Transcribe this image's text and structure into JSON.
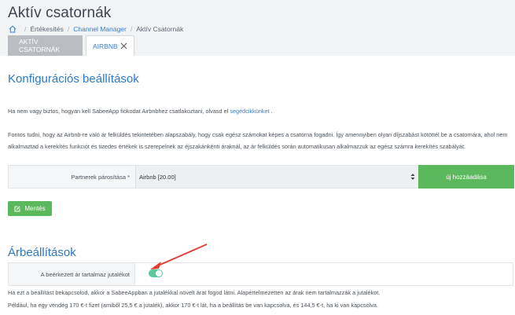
{
  "header": {
    "title": "Aktív csatornák",
    "breadcrumb": [
      "Értékesítés",
      "Channel Manager",
      "Aktív Csatornák"
    ]
  },
  "tabs": [
    {
      "label": "AKTÍV CSATORNÁK"
    },
    {
      "label": "AIRBNB"
    }
  ],
  "config": {
    "title": "Konfigurációs beállítások",
    "help_text": "Ha nem vagy biztos, hogyan kell SabeeApp fiókodat Airbnbhez csatlakoztani, olvasd el",
    "help_link": "segédcikkünket",
    "help_suffix": ".",
    "rounding_line1": "Fontos tudni, hogy az Airbnb-re való ár felküldés tekintetében alapszabály, hogy csak egész számokat képes a csatorna fogadni. Így amennyiben olyan díjszabást kötöttél be a csatornára, ahol nem",
    "rounding_line2": "alkalmaztad a kerekítés funkciót és tizedes értékek is szerepelnek az éjszakánkénti áraknál, az ár felküldés során automatikusan alkalmazzuk az egész számra kerekítés szabályát.",
    "pair_label": "Partnerek párosítása *",
    "pair_value": "Airbnb [20.00]",
    "add_button": "új hozzáadása",
    "save_button": "Mentés"
  },
  "pricing": {
    "title": "Árbeállítások",
    "toggle_label": "A beérkezett ár tartalmaz jutalékot",
    "toggle_on": true,
    "note_line1": "Ha ezt a beállítást bekapcsolod, akkor a SabeeAppban a jutalékkal növelt árat fogod látni. Alapértelmezetten az árak nem tartalmazzák a jutalékot.",
    "note_line2": "Például, ha egy vendég 170 €-t fizet (amiből 25,5 € a jutalék), akkor 170 €-t lát, ha a beállítás be van kapcsolva, és 144,5 €-t, ha ki van kapcsolva."
  },
  "colors": {
    "accent": "#2e79c2",
    "button_green": "#5cb85c",
    "toggle_green": "#5cc79b",
    "annotation_arrow": "#e53a2f"
  }
}
